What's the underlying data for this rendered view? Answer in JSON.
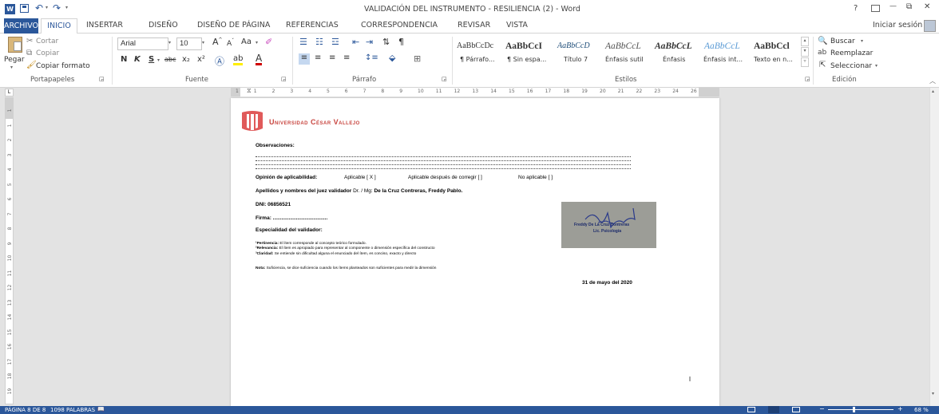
{
  "title_bar": {
    "title": "VALIDACIÓN DEL INSTRUMENTO - RESILIENCIA (2) - Word",
    "app_icon": "W",
    "help": "?",
    "controls": {
      "minimize": "—",
      "restore": "⧉",
      "close": "✕"
    }
  },
  "tabs": [
    {
      "label": "ARCHIVO"
    },
    {
      "label": "INICIO"
    },
    {
      "label": "INSERTAR"
    },
    {
      "label": "DISEÑO"
    },
    {
      "label": "DISEÑO DE PÁGINA"
    },
    {
      "label": "REFERENCIAS"
    },
    {
      "label": "CORRESPONDENCIA"
    },
    {
      "label": "REVISAR"
    },
    {
      "label": "VISTA"
    }
  ],
  "signin": "Iniciar sesión",
  "ribbon": {
    "clipboard": {
      "paste": "Pegar",
      "cut": "Cortar",
      "copy": "Copiar",
      "format_painter": "Copiar formato",
      "group": "Portapapeles"
    },
    "font": {
      "family": "Arial",
      "size": "10",
      "case_label": "Aa",
      "bold": "N",
      "italic": "K",
      "underline": "S",
      "strike": "abc",
      "subscript": "x₂",
      "superscript": "x²",
      "group": "Fuente"
    },
    "paragraph": {
      "group": "Párrafo"
    },
    "styles": {
      "items": [
        {
          "sample": "AaBbCcDc",
          "name": "¶ Párrafo..."
        },
        {
          "sample": "AaBbCcI",
          "name": "¶ Sin espa..."
        },
        {
          "sample": "AaBbCcD",
          "name": "Título 7"
        },
        {
          "sample": "AaBbCcL",
          "name": "Énfasis sutil"
        },
        {
          "sample": "AaBbCcL",
          "name": "Énfasis"
        },
        {
          "sample": "AaBbCcL",
          "name": "Énfasis int..."
        },
        {
          "sample": "AaBbCcl",
          "name": "Texto en n..."
        }
      ],
      "group": "Estilos"
    },
    "editing": {
      "find": "Buscar",
      "replace": "Reemplazar",
      "select": "Seleccionar",
      "group": "Edición"
    }
  },
  "ruler": {
    "h_ticks": [
      "1",
      "1",
      "2",
      "3",
      "4",
      "5",
      "6",
      "7",
      "8",
      "9",
      "10",
      "11",
      "12",
      "13",
      "14",
      "15",
      "16",
      "17",
      "18",
      "19",
      "20",
      "21",
      "22",
      "23",
      "24",
      "26"
    ],
    "v_ticks": [
      "1",
      "1",
      "2",
      "3",
      "4",
      "5",
      "6",
      "7",
      "8",
      "9",
      "10",
      "11",
      "12",
      "13",
      "14",
      "15",
      "16",
      "17",
      "18",
      "19"
    ]
  },
  "document": {
    "university": "Universidad César Vallejo",
    "obs_label": "Observaciones:",
    "opinion_label": "Opinión de aplicabilidad:",
    "opt1": "Aplicable [ X ]",
    "opt2": "Aplicable después de corregir [  ]",
    "opt3": "No aplicable [  ]",
    "judge_label": "Apellidos y nombres del juez validador",
    "judge_title": "Dr. / Mg:",
    "judge_name": "De la Cruz Contreras, Freddy Pablo.",
    "dni": "DNI: 06856521",
    "firma": "Firma: ......................................",
    "specialty": "Especialidad del validador:",
    "note1_label": "¹Pertinencia:",
    "note1": " El ítem corresponde al concepto teórico formulado.",
    "note2_label": "²Relevancia:",
    "note2": " El ítem es apropiado para representar al componente o dimensión específica del constructo",
    "note3_label": "³Claridad:",
    "note3": " Se entiende sin dificultad alguna el enunciado del ítem, es conciso, exacto y directo",
    "nota_label": "Nota:",
    "nota": " Suficiencia, se dice suficiencia cuando los ítems planteados son suficientes para medir la dimensión",
    "date": "31 de mayo del 2020",
    "stamp_line1": "Freddy De La Cruz Contreras",
    "stamp_line2": "Lic. Psicología"
  },
  "status_bar": {
    "page": "PÁGINA 8 DE 8",
    "words": "1098 PALABRAS",
    "zoom": "68 %"
  }
}
